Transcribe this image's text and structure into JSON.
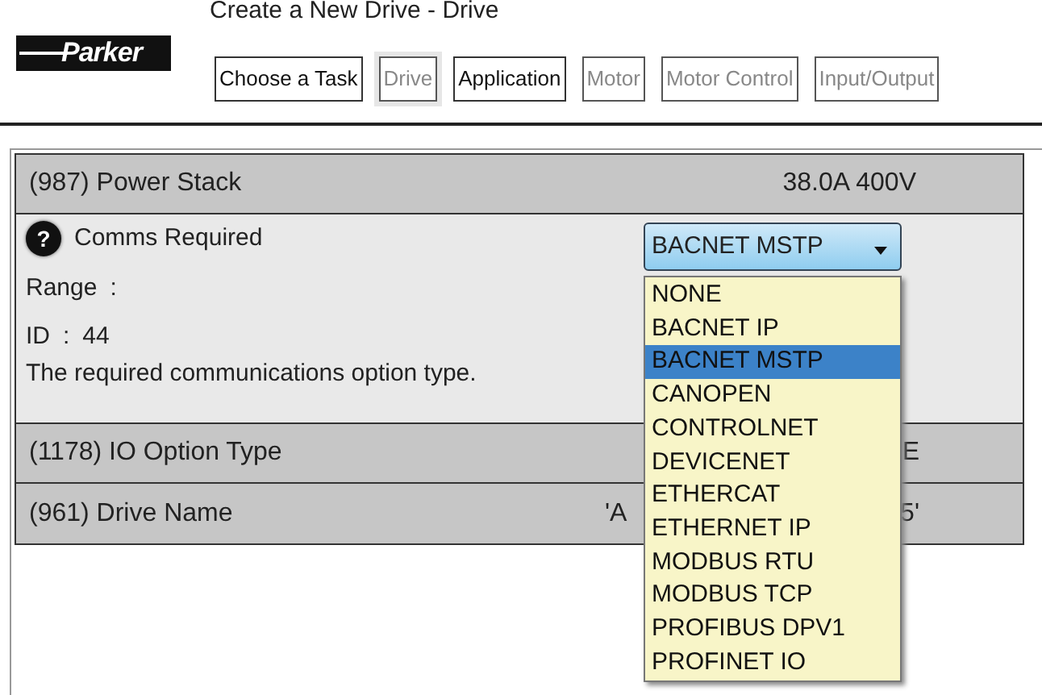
{
  "logo": {
    "text": "Parker"
  },
  "header": {
    "title": "Create a New Drive - Drive"
  },
  "tabs": [
    {
      "label": "Choose a Task",
      "selected": false,
      "disabled": false
    },
    {
      "label": "Drive",
      "selected": true,
      "disabled": true
    },
    {
      "label": "Application",
      "selected": false,
      "disabled": false
    },
    {
      "label": "Motor",
      "selected": false,
      "disabled": true
    },
    {
      "label": "Motor Control",
      "selected": false,
      "disabled": true
    },
    {
      "label": "Input/Output",
      "selected": false,
      "disabled": true
    }
  ],
  "parameters": [
    {
      "kind": "row",
      "label": "(987) Power Stack",
      "value": "38.0A 400V"
    },
    {
      "kind": "detail",
      "help_glyph": "?",
      "label": "Comms Required",
      "range_label": "Range",
      "range_sep": ":",
      "id_label": "ID",
      "id_sep": ":",
      "id_value": "44",
      "description": "The required communications option type.",
      "select": {
        "value": "BACNET MSTP",
        "expanded": true,
        "options": [
          {
            "label": "NONE",
            "selected": false
          },
          {
            "label": "BACNET IP",
            "selected": false
          },
          {
            "label": "BACNET MSTP",
            "selected": true
          },
          {
            "label": "CANOPEN",
            "selected": false
          },
          {
            "label": "CONTROLNET",
            "selected": false
          },
          {
            "label": "DEVICENET",
            "selected": false
          },
          {
            "label": "ETHERCAT",
            "selected": false
          },
          {
            "label": "ETHERNET IP",
            "selected": false
          },
          {
            "label": "MODBUS RTU",
            "selected": false
          },
          {
            "label": "MODBUS TCP",
            "selected": false
          },
          {
            "label": "PROFIBUS DPV1",
            "selected": false
          },
          {
            "label": "PROFINET IO",
            "selected": false
          }
        ]
      }
    },
    {
      "kind": "row",
      "label": "(1178) IO Option Type",
      "value_end": "E"
    },
    {
      "kind": "row",
      "label": "(961) Drive Name",
      "value_start": "'A",
      "value_end": "5'"
    }
  ]
}
